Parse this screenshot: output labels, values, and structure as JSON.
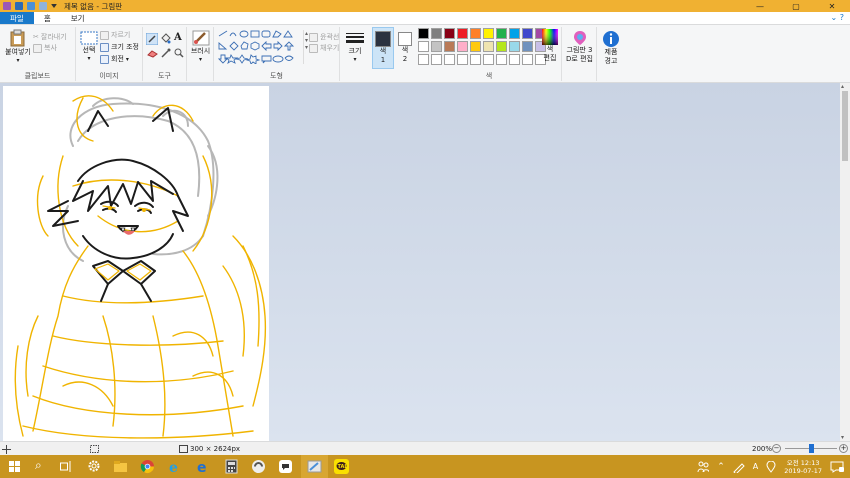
{
  "window": {
    "title": "제목 없음 - 그림판",
    "minimize": "—",
    "maximize": "▢",
    "close": "✕"
  },
  "tabs": [
    {
      "label": "파일"
    },
    {
      "label": "홈"
    },
    {
      "label": "보기"
    }
  ],
  "help_icon": "⌄ ?",
  "ribbon": {
    "clipboard": {
      "paste": "붙여넣기",
      "cut": "잘라내기",
      "copy": "복사",
      "label": "클립보드"
    },
    "image": {
      "select": "선택",
      "crop": "자르기",
      "resize": "크기 조정",
      "rotate": "회전",
      "label": "이미지"
    },
    "tools": {
      "label": "도구",
      "text_tool": "A"
    },
    "brushes": {
      "label": "브러시"
    },
    "shapes": {
      "outline": "윤곽선",
      "fill": "채우기",
      "label": "도형"
    },
    "size": {
      "label": "크기"
    },
    "color1": {
      "label": "색\n1",
      "value": "#2b3240"
    },
    "color2": {
      "label": "색\n2",
      "value": "#ffffff"
    },
    "colors": {
      "label": "색",
      "palette": [
        "#000000",
        "#7f7f7f",
        "#880015",
        "#ed1c24",
        "#ff7f27",
        "#fff200",
        "#22b14c",
        "#00a2e8",
        "#3f48cc",
        "#a349a4",
        "#ffffff",
        "#c3c3c3",
        "#b97a57",
        "#ffaec9",
        "#ffc90e",
        "#efe4b0",
        "#b5e61d",
        "#99d9ea",
        "#7092be",
        "#c8bfe7",
        "#ffffff",
        "#ffffff",
        "#ffffff",
        "#ffffff",
        "#ffffff",
        "#ffffff",
        "#ffffff",
        "#ffffff",
        "#ffffff",
        "#ffffff"
      ]
    },
    "edit_colors": "색\n편집",
    "paint3d": "그림판 3\nD로 편집",
    "product_alert": "제품\n경고"
  },
  "status": {
    "canvas_size": "300 × 2624px",
    "zoom": "200%"
  },
  "taskbar": {
    "search_icon": "⌕",
    "time": "오전 12:13",
    "date": "2019-07-17",
    "ime": "A"
  }
}
